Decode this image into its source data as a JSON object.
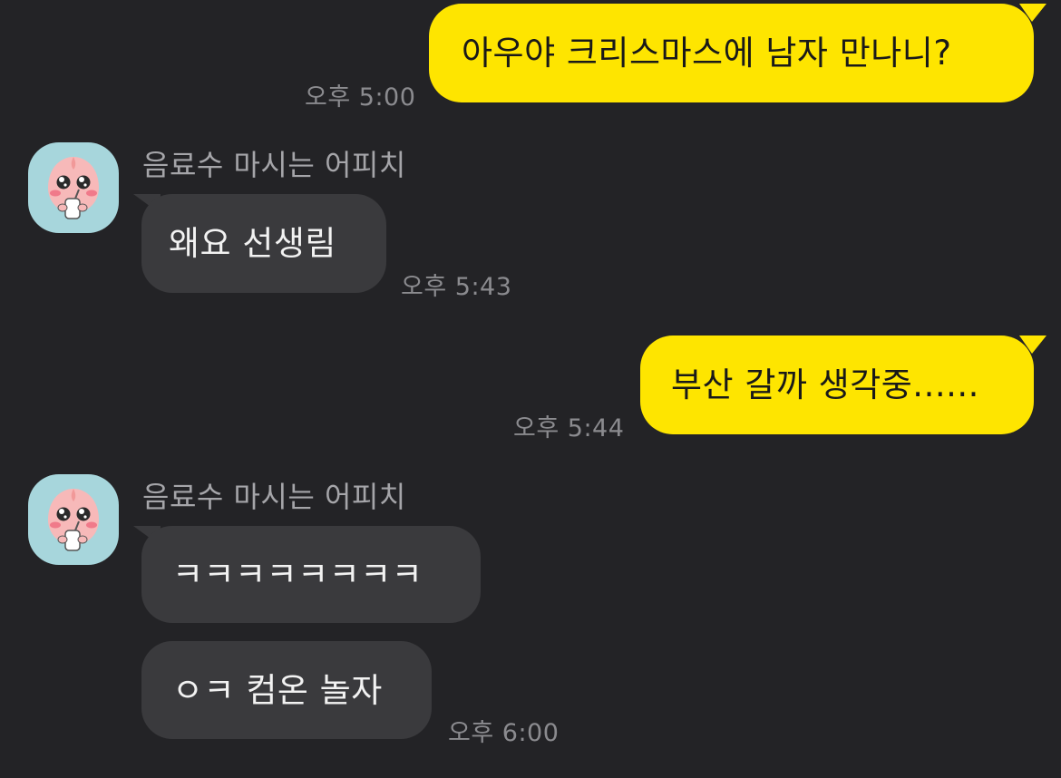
{
  "colors": {
    "background": "#232326",
    "my_bubble": "#FEE500",
    "their_bubble": "#3A3A3D",
    "timestamp": "#8B8B8F",
    "sender_name": "#A5A5A9",
    "avatar_bg": "#A7D6DC"
  },
  "icons": {
    "avatar": "apeach-drinking-avatar-icon"
  },
  "messages": {
    "m1": {
      "text": "아우야 크리스마스에 남자 만나니?",
      "time": "오후 5:00"
    },
    "g1": {
      "sender": "음료수 마시는 어피치",
      "b1": {
        "text": "왜요 선생림"
      },
      "time": "오후 5:43"
    },
    "m2": {
      "text": "부산 갈까 생각중......",
      "time": "오후 5:44"
    },
    "g2": {
      "sender": "음료수 마시는 어피치",
      "b1": {
        "text": "ㅋㅋㅋㅋㅋㅋㅋㅋ"
      },
      "b2": {
        "text": "ㅇㅋ 컴온 놀자"
      },
      "time": "오후 6:00"
    }
  }
}
